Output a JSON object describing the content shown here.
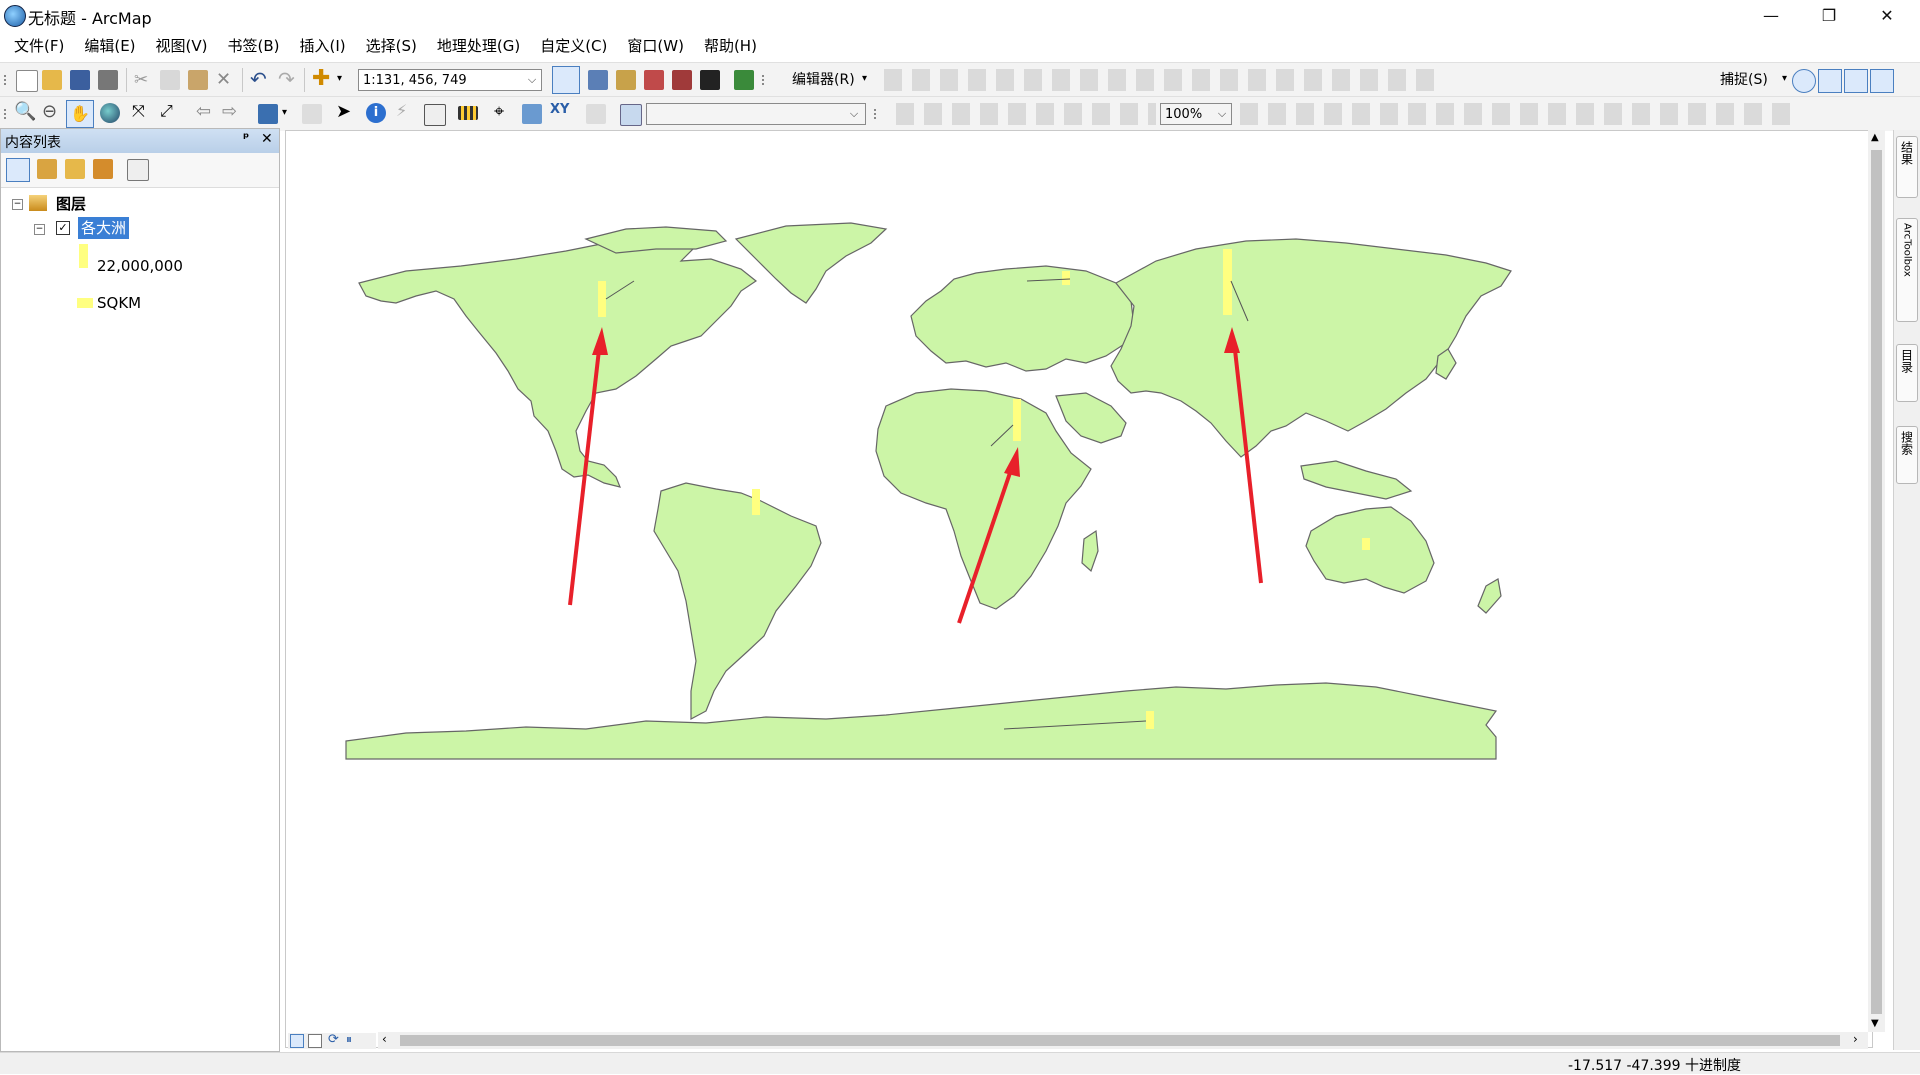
{
  "window": {
    "title": "无标题 - ArcMap",
    "minimize_glyph": "—",
    "restore_glyph": "❐",
    "close_glyph": "✕"
  },
  "menu": [
    "文件(F)",
    "编辑(E)",
    "视图(V)",
    "书签(B)",
    "插入(I)",
    "选择(S)",
    "地理处理(G)",
    "自定义(C)",
    "窗口(W)",
    "帮助(H)"
  ],
  "toolbar": {
    "scale_value": "1:131, 456, 749",
    "editor_label": "编辑器(R)",
    "snapping_label": "捕捉(S)",
    "zoom_value": "100%"
  },
  "toc": {
    "title": "内容列表",
    "pin_glyph": "ᵖ",
    "close_glyph": "✕",
    "root_label": "图层",
    "layer_label": "各大洲",
    "legend_value_label": "22,000,000",
    "legend_field_label": "SQKM"
  },
  "right_dock": {
    "results": "结果",
    "toolbox": "ArcToolbox",
    "catalog": "目录",
    "search": "搜索"
  },
  "status": {
    "coords": "-17.517 -47.399 十进制度"
  },
  "colors": {
    "land": "#ccf5a7",
    "bar": "#ffff80",
    "arrow": "#e8202a",
    "selection": "#3a7fd5"
  }
}
